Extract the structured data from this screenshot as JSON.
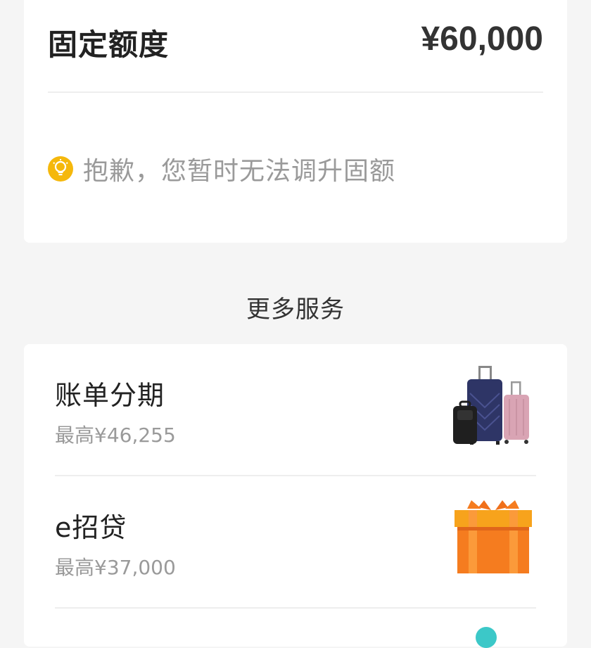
{
  "credit": {
    "limit_label": "固定额度",
    "limit_amount": "¥60,000",
    "tip_icon": "lightbulb-icon",
    "tip_text": "抱歉，您暂时无法调升固额"
  },
  "services": {
    "section_title": "更多服务",
    "items": [
      {
        "name": "账单分期",
        "sub": "最高¥46,255",
        "icon": "luggage-icon"
      },
      {
        "name": "e招贷",
        "sub": "最高¥37,000",
        "icon": "gift-box-icon"
      }
    ]
  },
  "colors": {
    "background": "#f5f5f5",
    "card": "#ffffff",
    "accent_yellow": "#f5b80c",
    "gift_orange": "#f57c1f",
    "luggage_navy": "#2e3566",
    "luggage_pink": "#d9a4b4"
  }
}
